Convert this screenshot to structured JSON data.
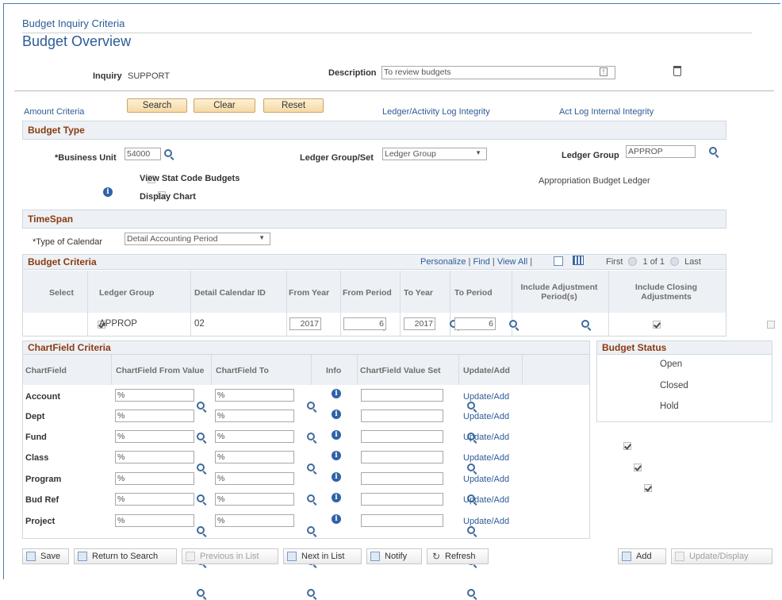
{
  "breadcrumb": "Budget Inquiry Criteria",
  "page_title": "Budget Overview",
  "inquiry": {
    "label": "Inquiry",
    "value": "SUPPORT"
  },
  "description": {
    "label": "Description",
    "value": "To review budgets"
  },
  "links": {
    "amount_criteria": "Amount Criteria",
    "ledger_activity": "Ledger/Activity Log Integrity",
    "act_log": "Act Log Internal Integrity"
  },
  "buttons": {
    "search": "Search",
    "clear": "Clear",
    "reset": "Reset"
  },
  "budget_type": {
    "header": "Budget Type",
    "business_unit_label": "*Business Unit",
    "business_unit_value": "54000",
    "ledger_group_set_label": "Ledger Group/Set",
    "ledger_group_set_value": "Ledger Group",
    "ledger_group_label": "Ledger Group",
    "ledger_group_value": "APPROP",
    "view_stat": "View Stat Code Budgets",
    "display_chart": "Display Chart",
    "ledger_desc": "Appropriation Budget Ledger"
  },
  "timespan": {
    "header": "TimeSpan",
    "calendar_label": "*Type of Calendar",
    "calendar_value": "Detail Accounting Period"
  },
  "budget_criteria": {
    "header": "Budget Criteria",
    "personalize": "Personalize",
    "find": "Find",
    "view_all": "View All",
    "first": "First",
    "count": "1 of 1",
    "last": "Last",
    "columns": [
      "Select",
      "Ledger Group",
      "Detail Calendar ID",
      "From Year",
      "From Period",
      "To Year",
      "To Period",
      "Include Adjustment Period(s)",
      "Include Closing Adjustments"
    ],
    "row": {
      "ledger_group": "APPROP",
      "calendar_id": "02",
      "from_year": "2017",
      "from_period": "6",
      "to_year": "2017",
      "to_period": "6"
    }
  },
  "chartfield": {
    "header": "ChartField Criteria",
    "columns": [
      "ChartField",
      "ChartField From Value",
      "ChartField To",
      "Info",
      "ChartField Value Set",
      "Update/Add"
    ],
    "rows": [
      {
        "name": "Account",
        "from": "%",
        "to": "%",
        "link": "Update/Add"
      },
      {
        "name": "Dept",
        "from": "%",
        "to": "%",
        "link": "Update/Add"
      },
      {
        "name": "Fund",
        "from": "%",
        "to": "%",
        "link": "Update/Add"
      },
      {
        "name": "Class",
        "from": "%",
        "to": "%",
        "link": "Update/Add"
      },
      {
        "name": "Program",
        "from": "%",
        "to": "%",
        "link": "Update/Add"
      },
      {
        "name": "Bud Ref",
        "from": "%",
        "to": "%",
        "link": "Update/Add"
      },
      {
        "name": "Project",
        "from": "%",
        "to": "%",
        "link": "Update/Add"
      }
    ]
  },
  "budget_status": {
    "header": "Budget Status",
    "items": [
      "Open",
      "Closed",
      "Hold"
    ]
  },
  "toolbar": {
    "save": "Save",
    "return": "Return to Search",
    "previous": "Previous in List",
    "next": "Next in List",
    "notify": "Notify",
    "refresh": "Refresh",
    "add": "Add",
    "update_display": "Update/Display"
  }
}
